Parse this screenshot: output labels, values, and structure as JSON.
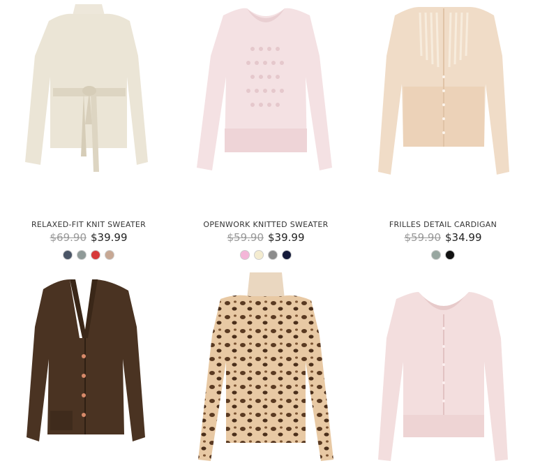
{
  "products": [
    {
      "name": "RELAXED-FIT KNIT SWEATER",
      "old_price": "$69.90",
      "new_price": "$39.99",
      "image_alt": "relaxed-fit knit sweater cream",
      "swatches": [
        "#4a5566",
        "#8f9a98",
        "#d63a3a",
        "#c7a894"
      ]
    },
    {
      "name": "OPENWORK KNITTED SWEATER",
      "old_price": "$59.90",
      "new_price": "$39.99",
      "image_alt": "openwork knitted sweater pink",
      "swatches": [
        "#f4b6d8",
        "#f4ecd0",
        "#8c8c8c",
        "#141a3a"
      ]
    },
    {
      "name": "FRILLES DETAIL CARDIGAN",
      "old_price": "$59.90",
      "new_price": "$34.99",
      "image_alt": "frilles detail cardigan beige",
      "swatches": [
        "#98a6a0",
        "#111111"
      ]
    },
    {
      "image_alt": "brown v-neck cardigan"
    },
    {
      "image_alt": "leopard print turtleneck"
    },
    {
      "image_alt": "pink knit cardigan"
    }
  ]
}
